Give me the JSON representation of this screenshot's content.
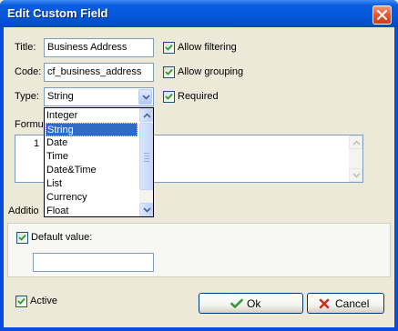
{
  "window": {
    "title": "Edit Custom Field"
  },
  "form": {
    "title_label": "Title:",
    "title_value": "Business Address",
    "code_label": "Code:",
    "code_value": "cf_business_address",
    "type_label": "Type:",
    "type_value": "String",
    "formula_label": "Formul",
    "formula_line_number": "1",
    "additional_label": "Additio"
  },
  "checkboxes": {
    "allow_filtering": {
      "label": "Allow filtering",
      "checked": true
    },
    "allow_grouping": {
      "label": "Allow grouping",
      "checked": true
    },
    "required": {
      "label": "Required",
      "checked": true
    },
    "default_value": {
      "label": "Default value:",
      "checked": true
    },
    "active": {
      "label": "Active",
      "checked": true
    }
  },
  "type_dropdown": {
    "options": [
      "Integer",
      "String",
      "Date",
      "Time",
      "Date&Time",
      "List",
      "Currency",
      "Float"
    ],
    "selected": "String"
  },
  "default_value_input": "",
  "buttons": {
    "ok_label": "Ok",
    "cancel_label": "Cancel"
  },
  "colors": {
    "title_bar": "#0457d8",
    "selection": "#316ac5",
    "ok_icon": "#2f9a2f",
    "cancel_icon": "#d42b1e",
    "close_button": "#e2562a"
  },
  "icons": {
    "close": "close-icon",
    "check": "checkmark-icon",
    "dropdown_arrow": "chevron-down-icon",
    "ok": "green-checkmark-icon",
    "cancel": "red-x-icon"
  }
}
